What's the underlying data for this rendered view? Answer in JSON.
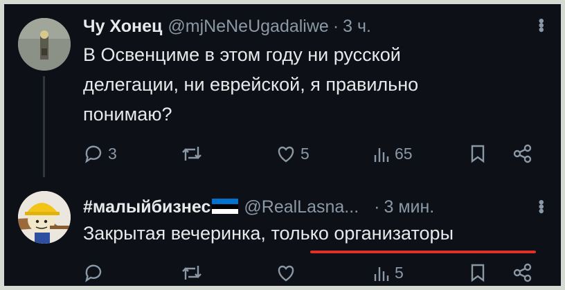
{
  "tweets": [
    {
      "name": "Чу Хонец",
      "handle": "@mjNeNeUgadaliwe",
      "separator": "·",
      "time": "3 ч.",
      "text": "В Освенциме в этом году ни русской делегации, ни еврейской, я правильно понимаю?",
      "stats": {
        "replies": "3",
        "reposts": "",
        "likes": "5",
        "views": "65"
      }
    },
    {
      "name": "#малыйбизнес",
      "handle": "@RealLasna...",
      "separator": "·",
      "time": "3 мин.",
      "text_plain": "Закрытая вечеринка, ",
      "text_highlight": "только организаторы",
      "stats": {
        "replies": "",
        "reposts": "",
        "likes": "",
        "views": "5"
      },
      "flag_colors": [
        "#0072ce",
        "#000000",
        "#ffffff"
      ]
    }
  ],
  "icons": {
    "reply": "speech-bubble-icon",
    "repost": "repost-arrows-icon",
    "like": "heart-icon",
    "views": "bar-chart-icon",
    "bookmark": "bookmark-icon",
    "share": "share-icon",
    "more": "vertical-dots-icon"
  },
  "colors": {
    "background": "#0d1117",
    "text": "#e7e9ea",
    "muted": "#8b98a5",
    "highlight_underline": "#e0302a"
  }
}
